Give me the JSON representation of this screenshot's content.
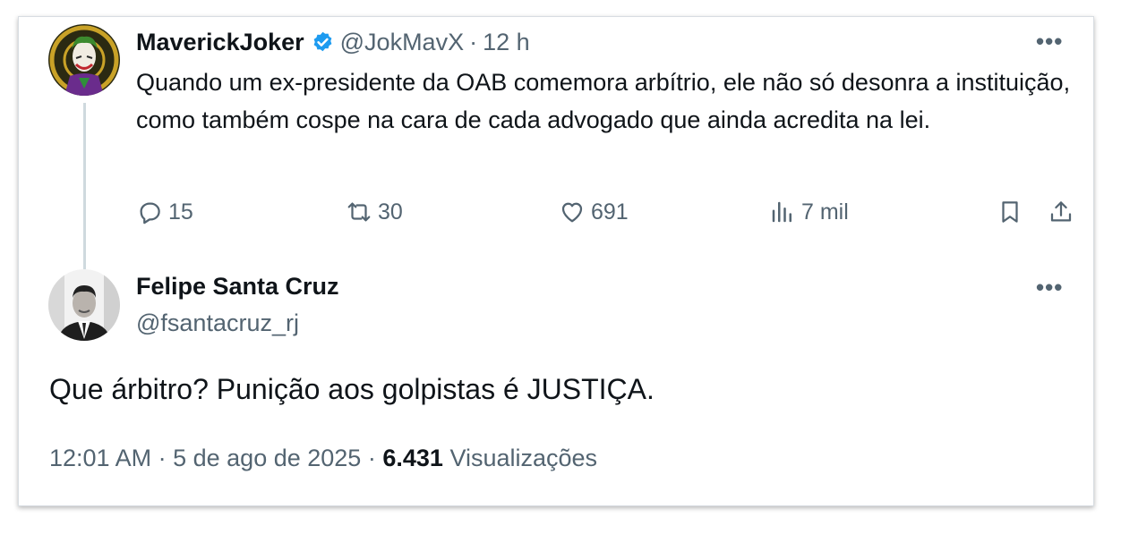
{
  "parent": {
    "display_name": "MaverickJoker",
    "handle": "@JokMavX",
    "separator": "·",
    "time": "12 h",
    "text": "Quando um ex-presidente da OAB comemora arbítrio, ele não só desonra a instituição, como também cospe na cara de cada advogado que ainda acredita na lei.",
    "more": "•••",
    "actions": {
      "replies": "15",
      "reposts": "30",
      "likes": "691",
      "views": "7 mil"
    },
    "verified_color": "#1d9bf0"
  },
  "reply": {
    "display_name": "Felipe Santa Cruz",
    "handle": "@fsantacruz_rj",
    "more": "•••",
    "text": "Que árbitro? Punição aos golpistas é JUSTIÇA.",
    "time": "12:01 AM",
    "sep1": "·",
    "date": "5 de ago de 2025",
    "sep2": "·",
    "views_count": "6.431",
    "views_label": "Visualizações"
  },
  "icons": {
    "reply": "comment-icon",
    "repost": "repost-icon",
    "like": "heart-icon",
    "views": "analytics-icon",
    "bookmark": "bookmark-icon",
    "share": "share-icon"
  }
}
